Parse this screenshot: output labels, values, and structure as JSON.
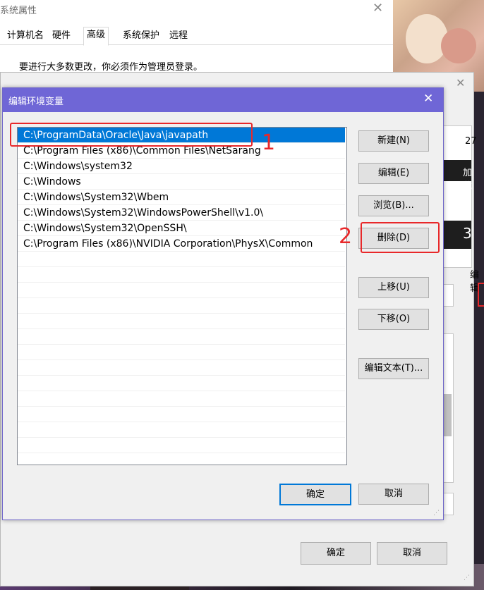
{
  "system_properties": {
    "title": "系统属性",
    "tabs": [
      "计算机名",
      "硬件",
      "高级",
      "系统保护",
      "远程"
    ],
    "active_tab": "高级",
    "admin_notice": "要进行大多数更改，你必须作为管理员登录。"
  },
  "env_window": {
    "ok_label": "确定",
    "cancel_label": "取消",
    "side_fragments": [
      "27",
      "加载",
      "3",
      "编辑"
    ]
  },
  "edit_dialog": {
    "title": "编辑环境变量",
    "paths": [
      "C:\\ProgramData\\Oracle\\Java\\javapath",
      "C:\\Program Files (x86)\\Common Files\\NetSarang",
      "C:\\Windows\\system32",
      "C:\\Windows",
      "C:\\Windows\\System32\\Wbem",
      "C:\\Windows\\System32\\WindowsPowerShell\\v1.0\\",
      "C:\\Windows\\System32\\OpenSSH\\",
      "C:\\Program Files (x86)\\NVIDIA Corporation\\PhysX\\Common"
    ],
    "selected_index": 0,
    "buttons": {
      "new": "新建(N)",
      "edit": "编辑(E)",
      "browse": "浏览(B)...",
      "delete": "删除(D)",
      "move_up": "上移(U)",
      "move_down": "下移(O)",
      "edit_text": "编辑文本(T)...",
      "ok": "确定",
      "cancel": "取消"
    },
    "annotations": [
      "1",
      "2"
    ]
  },
  "colors": {
    "titlebar": "#6f66d6",
    "selection": "#0078d7",
    "annotation": "#e8282a"
  }
}
